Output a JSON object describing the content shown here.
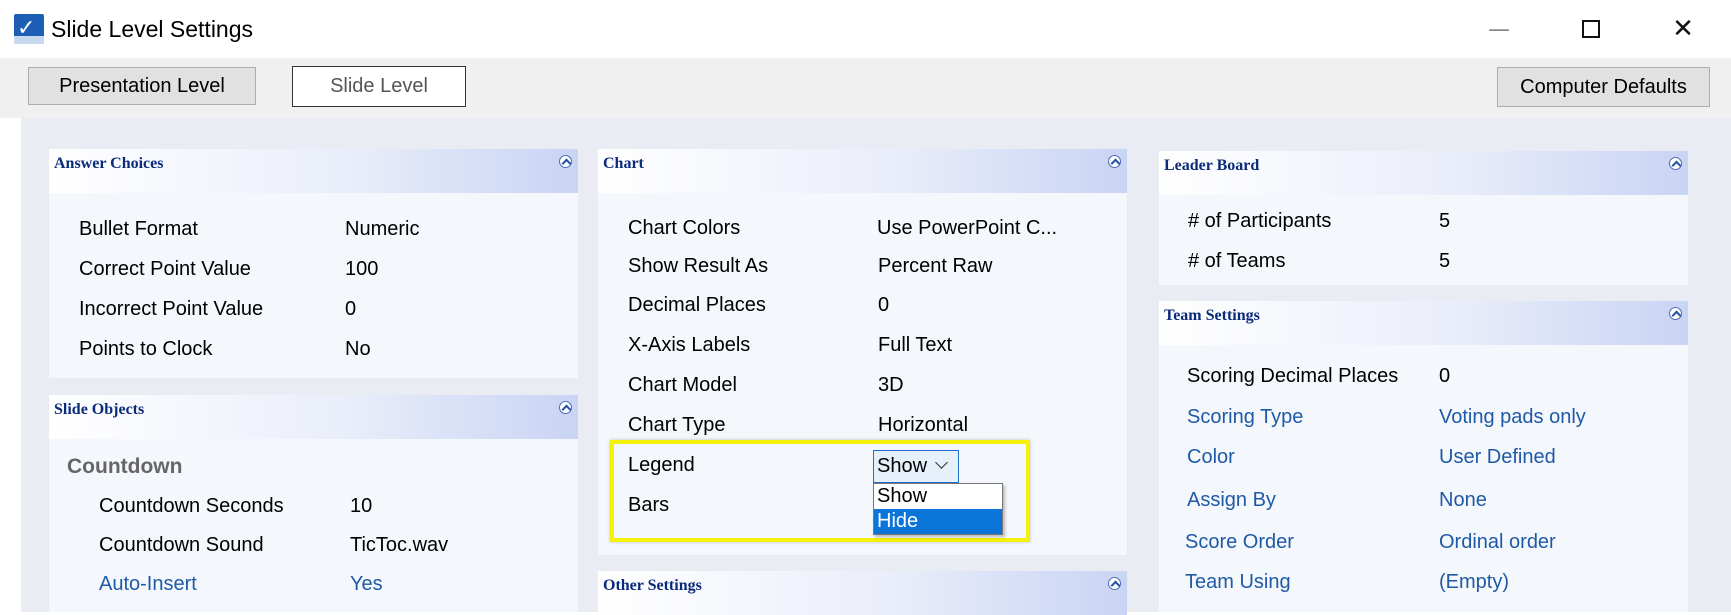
{
  "window": {
    "title": "Slide Level Settings",
    "icons": {
      "app": "app-logo-icon",
      "minimize": "minimize-icon",
      "maximize": "maximize-icon",
      "close": "close-icon"
    },
    "minimize_glyph": "—",
    "maximize_glyph": "☐",
    "close_glyph": "✕"
  },
  "toolbar": {
    "presentation_level": "Presentation Level",
    "slide_level": "Slide Level",
    "computer_defaults": "Computer Defaults"
  },
  "panels": {
    "answer_choices": {
      "title": "Answer Choices",
      "rows": [
        {
          "label": "Bullet Format",
          "value": "Numeric"
        },
        {
          "label": "Correct Point Value",
          "value": "100"
        },
        {
          "label": "Incorrect Point Value",
          "value": "0"
        },
        {
          "label": "Points to Clock",
          "value": "No"
        }
      ]
    },
    "slide_objects": {
      "title": "Slide Objects",
      "section": "Countdown",
      "rows": [
        {
          "label": "Countdown Seconds",
          "value": "10"
        },
        {
          "label": "Countdown Sound",
          "value": "TicToc.wav"
        },
        {
          "label": "Auto-Insert",
          "value": "Yes"
        }
      ]
    },
    "chart": {
      "title": "Chart",
      "rows": [
        {
          "label": "Chart Colors",
          "value": "Use PowerPoint C..."
        },
        {
          "label": "Show Result As",
          "value": "Percent Raw"
        },
        {
          "label": "Decimal Places",
          "value": "0"
        },
        {
          "label": "X-Axis Labels",
          "value": "Full Text"
        },
        {
          "label": "Chart Model",
          "value": "3D"
        },
        {
          "label": "Chart Type",
          "value": "Horizontal"
        },
        {
          "label": "Legend",
          "value": "Show"
        },
        {
          "label": "Bars",
          "value": ""
        }
      ],
      "legend_dropdown": {
        "selected": "Show",
        "options": [
          "Show",
          "Hide"
        ],
        "highlighted": "Hide"
      }
    },
    "other_settings": {
      "title": "Other Settings"
    },
    "leader_board": {
      "title": "Leader Board",
      "rows": [
        {
          "label": "# of Participants",
          "value": "5"
        },
        {
          "label": "# of Teams",
          "value": "5"
        }
      ]
    },
    "team_settings": {
      "title": "Team Settings",
      "rows": [
        {
          "label": "Scoring Decimal Places",
          "value": "0"
        },
        {
          "label": "Scoring Type",
          "value": "Voting pads only"
        },
        {
          "label": "Color",
          "value": "User Defined"
        },
        {
          "label": "Assign By",
          "value": "None"
        },
        {
          "label": "Score Order",
          "value": "Ordinal order"
        },
        {
          "label": "Team Using",
          "value": "(Empty)"
        }
      ]
    }
  },
  "colors": {
    "panel_title": "#0a2a7a",
    "link_blue": "#1f5aa6",
    "highlight_yellow": "#f2f20a",
    "selected_option": "#0a74d9"
  }
}
